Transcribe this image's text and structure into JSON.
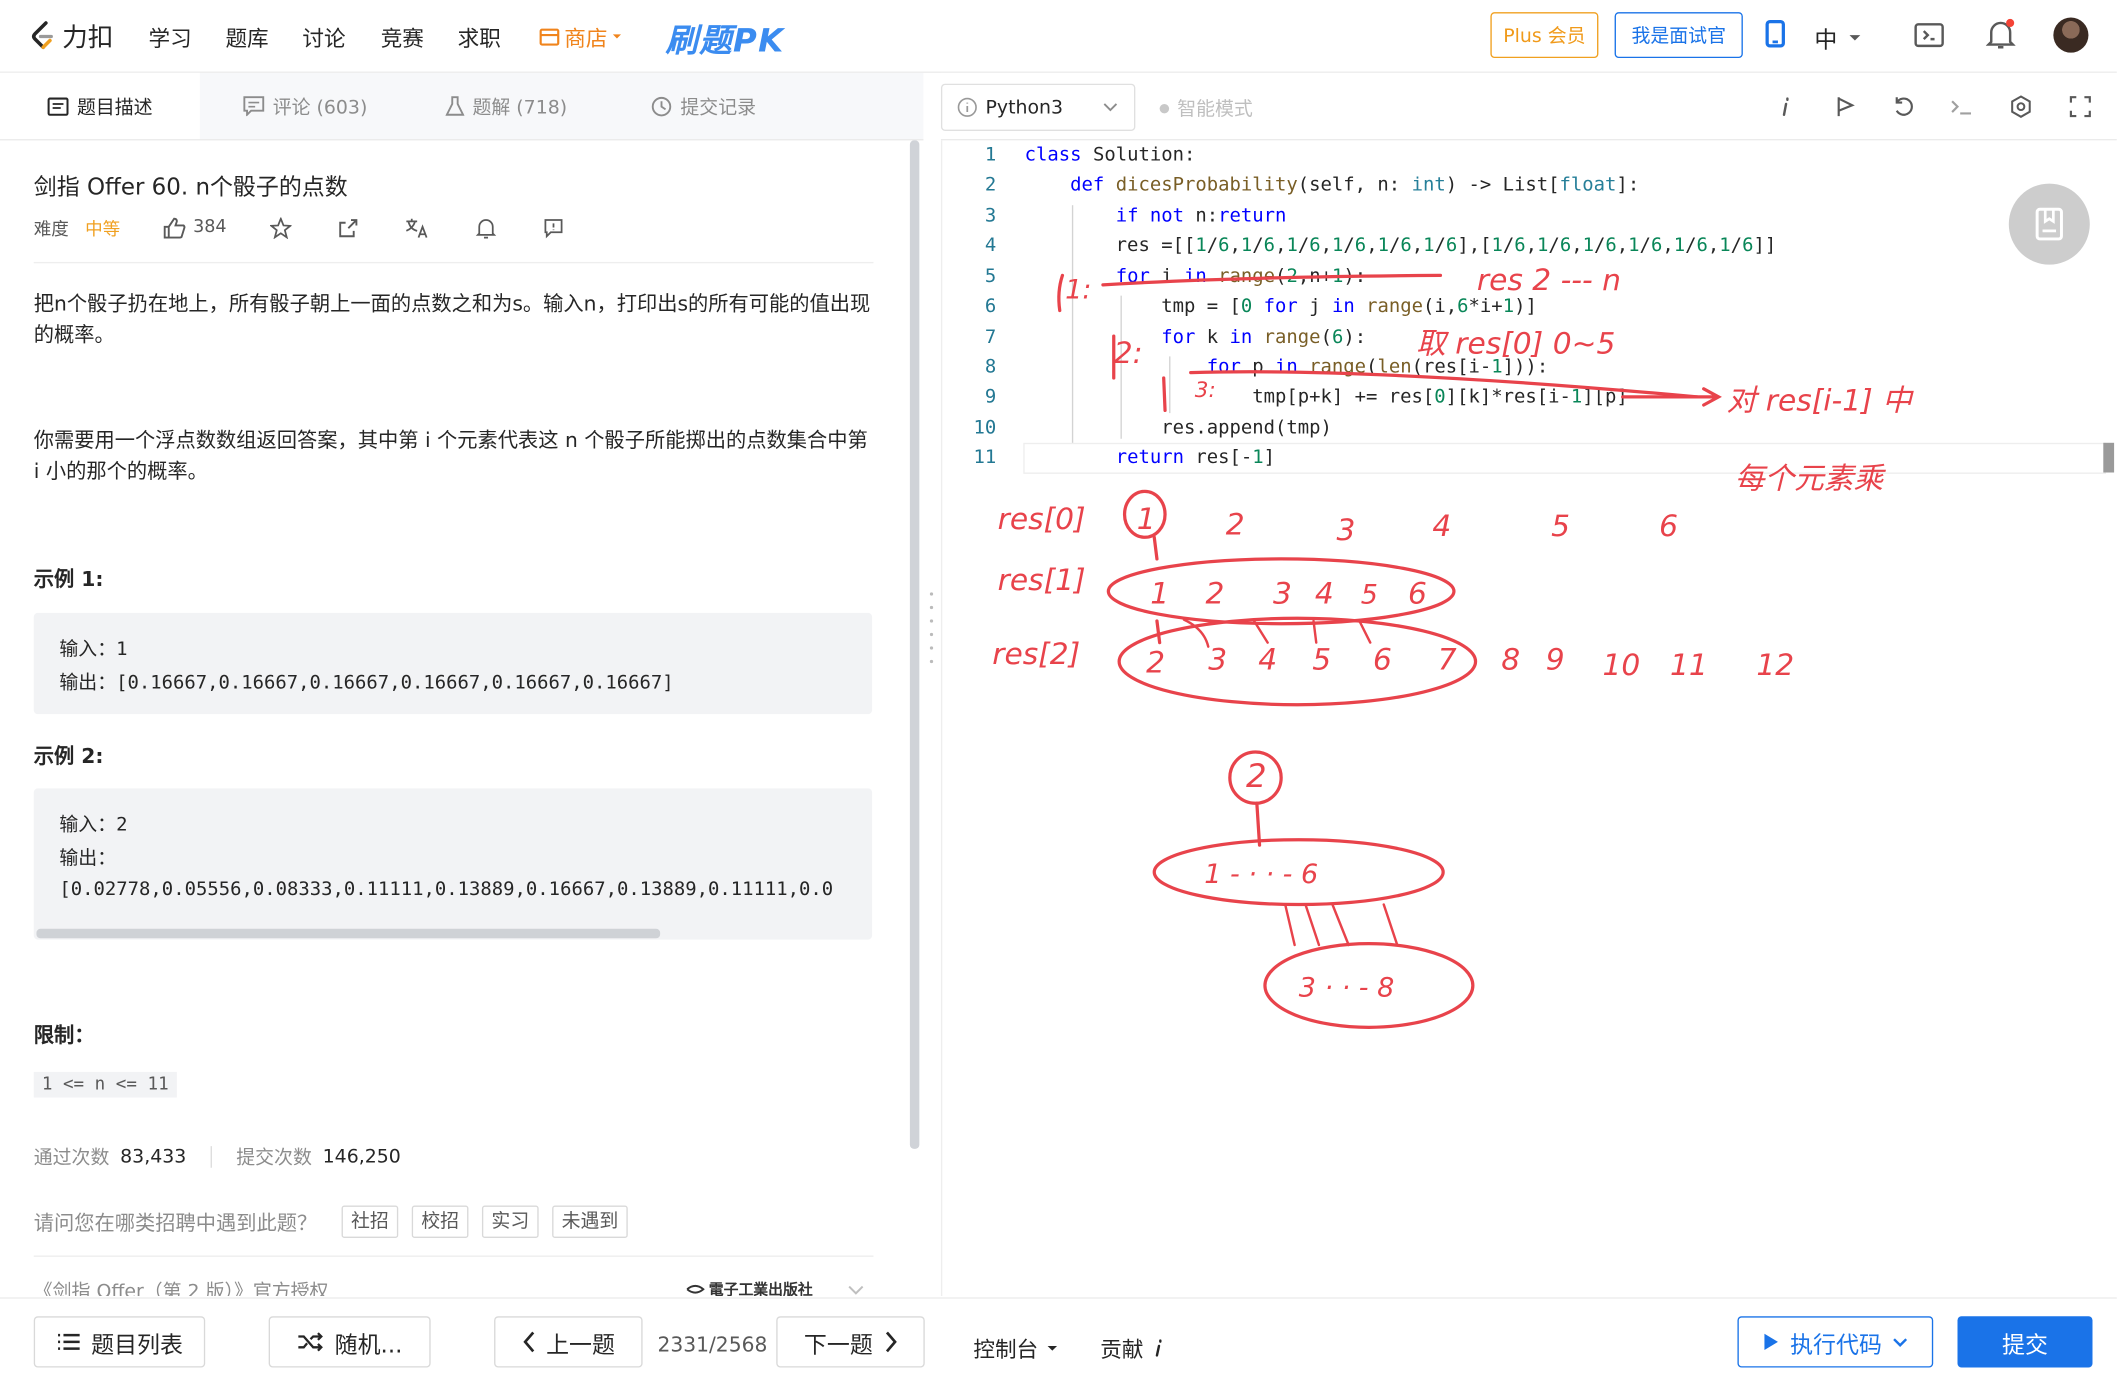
{
  "nav": {
    "logo": "力扣",
    "items": [
      "学习",
      "题库",
      "讨论",
      "竞赛",
      "求职"
    ],
    "store": "商店",
    "pk_logo": "刷题PK",
    "plus": "Plus 会员",
    "interviewer": "我是面试官",
    "lang": "中"
  },
  "tabs": {
    "desc": "题目描述",
    "comments": "评论 (603)",
    "solutions": "题解 (718)",
    "submissions": "提交记录"
  },
  "problem": {
    "title": "剑指 Offer 60. n个骰子的点数",
    "difficulty_label": "难度",
    "difficulty": "中等",
    "likes": "384",
    "desc1": "把n个骰子扔在地上，所有骰子朝上一面的点数之和为s。输入n，打印出s的所有可能的值出现的概率。",
    "desc2": "你需要用一个浮点数数组返回答案，其中第 i 个元素代表这 n 个骰子所能掷出的点数集合中第 i 小的那个的概率。",
    "ex1_title": "示例 1:",
    "ex1_in_label": "输入：",
    "ex1_in": "1",
    "ex1_out_label": "输出：",
    "ex1_out": "[0.16667,0.16667,0.16667,0.16667,0.16667,0.16667]",
    "ex2_title": "示例 2:",
    "ex2_in_label": "输入：",
    "ex2_in": "2",
    "ex2_out_label": "输出：",
    "ex2_out": "[0.02778,0.05556,0.08333,0.11111,0.13889,0.16667,0.13889,0.11111,0.0",
    "limit_title": "限制：",
    "limit": "1 <= n <= 11",
    "accepted_label": "通过次数",
    "accepted": "83,433",
    "submissions_label": "提交次数",
    "submissions": "146,250",
    "recruit_q": "请问您在哪类招聘中遇到此题？",
    "recruit_tags": [
      "社招",
      "校招",
      "实习",
      "未遇到"
    ],
    "license": "《剑指 Offer（第 2 版）》官方授权",
    "publisher": "電子工業出版社"
  },
  "editor": {
    "language": "Python3",
    "smart_mode": "智能模式",
    "line_numbers": [
      "1",
      "2",
      "3",
      "4",
      "5",
      "6",
      "7",
      "8",
      "9",
      "10",
      "11"
    ]
  },
  "annotations": {
    "note1": "res  2 --- n",
    "note2": "取 res[0] 0~5",
    "note3": "对 res[i-1] 中",
    "note4": "每个元素乘",
    "l1": "1:",
    "l2": "2:",
    "l3": "3:",
    "row0_label": "res[0]",
    "row0": [
      "1",
      "2",
      "3",
      "4",
      "5",
      "6"
    ],
    "row1_label": "res[1]",
    "row1": [
      "1",
      "2",
      "3",
      "4",
      "5",
      "6"
    ],
    "row2_label": "res[2]",
    "row2": [
      "2",
      "3",
      "4",
      "5",
      "6",
      "7",
      "8",
      "9",
      "10",
      "11",
      "12"
    ],
    "tree_root": "2",
    "tree_mid": "1 - · · - 6",
    "tree_bottom": "3 · · - 8"
  },
  "bottom": {
    "problem_list": "题目列表",
    "random": "随机...",
    "prev": "上一题",
    "page": "2331/2568",
    "next": "下一题",
    "console": "控制台",
    "contribute": "贡献",
    "run": "执行代码",
    "submit": "提交"
  },
  "colors": {
    "accent": "#1a73e8",
    "medium": "#f0a020",
    "ink": "#e8434b"
  }
}
